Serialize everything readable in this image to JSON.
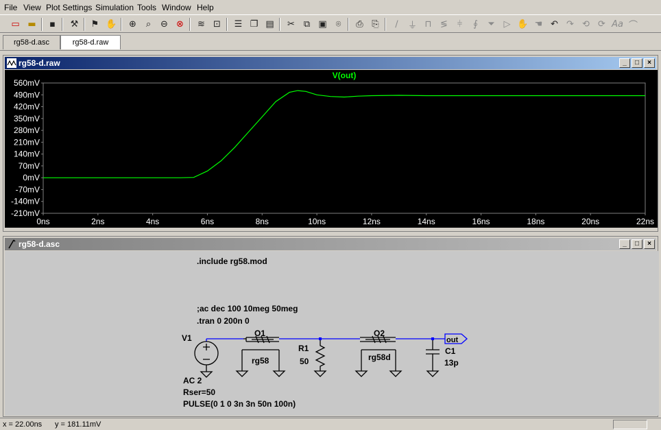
{
  "menu": [
    "File",
    "View",
    "Plot Settings",
    "Simulation",
    "Tools",
    "Window",
    "Help"
  ],
  "tabs": [
    {
      "label": "rg58-d.asc",
      "active": false
    },
    {
      "label": "rg58-d.raw",
      "active": true
    }
  ],
  "waveform_window": {
    "title": "rg58-d.raw",
    "trace_label": "V(out)",
    "trace_color": "#00ff00"
  },
  "schematic_window": {
    "title": "rg58-d.asc",
    "directives": {
      "include": ".include rg58.mod",
      "ac": ";ac dec 100 10meg 50meg",
      "tran": ".tran 0 200n 0"
    },
    "components": {
      "v1_name": "V1",
      "v1_ac": "AC 2",
      "v1_rser": "Rser=50",
      "v1_pulse": "PULSE(0 1 0 3n 3n 50n 100n)",
      "o1_name": "O1",
      "o1_model": "rg58",
      "r1_name": "R1",
      "r1_value": "50",
      "o2_name": "O2",
      "o2_model": "rg58d",
      "c1_name": "C1",
      "c1_value": "13p",
      "net_label": "out"
    },
    "wire_color": "#0000ff"
  },
  "status": {
    "x": "x = 22.00ns",
    "y": "y = 181.11mV"
  },
  "chart_data": {
    "type": "line",
    "title": "V(out)",
    "xlabel": "",
    "ylabel": "",
    "x_ticks": [
      "0ns",
      "2ns",
      "4ns",
      "6ns",
      "8ns",
      "10ns",
      "12ns",
      "14ns",
      "16ns",
      "18ns",
      "20ns",
      "22ns"
    ],
    "y_ticks": [
      "560mV",
      "490mV",
      "420mV",
      "350mV",
      "280mV",
      "210mV",
      "140mV",
      "70mV",
      "0mV",
      "-70mV",
      "-140mV",
      "-210mV"
    ],
    "xlim": [
      0,
      22
    ],
    "ylim": [
      -210,
      560
    ],
    "grid": false,
    "series": [
      {
        "name": "V(out)",
        "x": [
          0,
          5.0,
          5.5,
          6.0,
          6.5,
          7.0,
          7.5,
          8.0,
          8.5,
          9.0,
          9.3,
          9.6,
          10.0,
          10.5,
          11.0,
          11.5,
          12.0,
          13.0,
          14.0,
          16.0,
          18.0,
          20.0,
          22.0
        ],
        "values": [
          0,
          0,
          2,
          40,
          100,
          180,
          270,
          360,
          450,
          505,
          515,
          510,
          490,
          480,
          477,
          482,
          485,
          487,
          485,
          485,
          485,
          485,
          485
        ]
      }
    ]
  }
}
